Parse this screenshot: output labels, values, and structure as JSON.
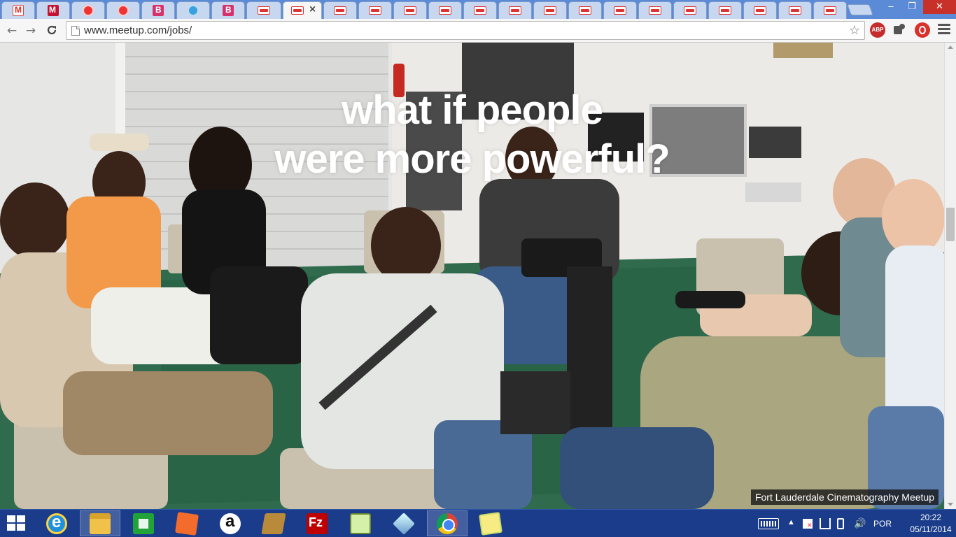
{
  "browser": {
    "tabs": [
      {
        "icon": "gmail-icon",
        "active": false
      },
      {
        "icon": "meetup-m-icon",
        "active": false
      },
      {
        "icon": "red-circle-icon",
        "active": false
      },
      {
        "icon": "red-circle-icon",
        "active": false
      },
      {
        "icon": "b-icon",
        "active": false
      },
      {
        "icon": "globe-icon",
        "active": false
      },
      {
        "icon": "b-icon",
        "active": false
      },
      {
        "icon": "meetup-icon",
        "active": false
      },
      {
        "icon": "meetup-icon",
        "active": true,
        "close": "×"
      },
      {
        "icon": "meetup-icon",
        "active": false
      },
      {
        "icon": "meetup-icon",
        "active": false
      },
      {
        "icon": "meetup-icon",
        "active": false
      },
      {
        "icon": "meetup-icon",
        "active": false
      },
      {
        "icon": "meetup-icon",
        "active": false
      },
      {
        "icon": "meetup-icon",
        "active": false
      },
      {
        "icon": "meetup-icon",
        "active": false
      },
      {
        "icon": "meetup-icon",
        "active": false
      },
      {
        "icon": "meetup-icon",
        "active": false
      },
      {
        "icon": "meetup-icon",
        "active": false
      },
      {
        "icon": "meetup-icon",
        "active": false
      },
      {
        "icon": "meetup-icon",
        "active": false
      },
      {
        "icon": "meetup-icon",
        "active": false
      },
      {
        "icon": "meetup-icon",
        "active": false
      }
    ],
    "window_buttons": {
      "minimize": "‒",
      "maximize": "❐",
      "close": "✕"
    },
    "nav": {
      "back": "←",
      "forward": "→",
      "reload": "C"
    },
    "url": "www.meetup.com/jobs/",
    "star": "☆",
    "extensions": {
      "abp": "ABP"
    }
  },
  "page": {
    "headline_line1": "what if people",
    "headline_line2": "were more powerful?",
    "photo_caption": "Fort Lauderdale Cinematography Meetup"
  },
  "taskbar": {
    "apps": [
      {
        "name": "internet-explorer",
        "running": false
      },
      {
        "name": "file-explorer",
        "running": true
      },
      {
        "name": "windows-store",
        "running": false
      },
      {
        "name": "paint",
        "running": false
      },
      {
        "name": "amazon",
        "running": false
      },
      {
        "name": "media-app",
        "running": false
      },
      {
        "name": "filezilla",
        "running": false
      },
      {
        "name": "notepad-plus",
        "running": false
      },
      {
        "name": "3d-cube-app",
        "running": false
      },
      {
        "name": "chrome",
        "running": true
      },
      {
        "name": "sticky-notes",
        "running": false
      }
    ],
    "tray": {
      "arrow": "▲",
      "volume": "🔊",
      "language": "POR"
    },
    "clock": {
      "time": "20:22",
      "date": "05/11/2014"
    }
  },
  "colors": {
    "tabstrip": "#5b8bd6",
    "taskbar": "#1a3c8a",
    "close_button": "#c7312a",
    "floor": "#2f6b4c"
  }
}
